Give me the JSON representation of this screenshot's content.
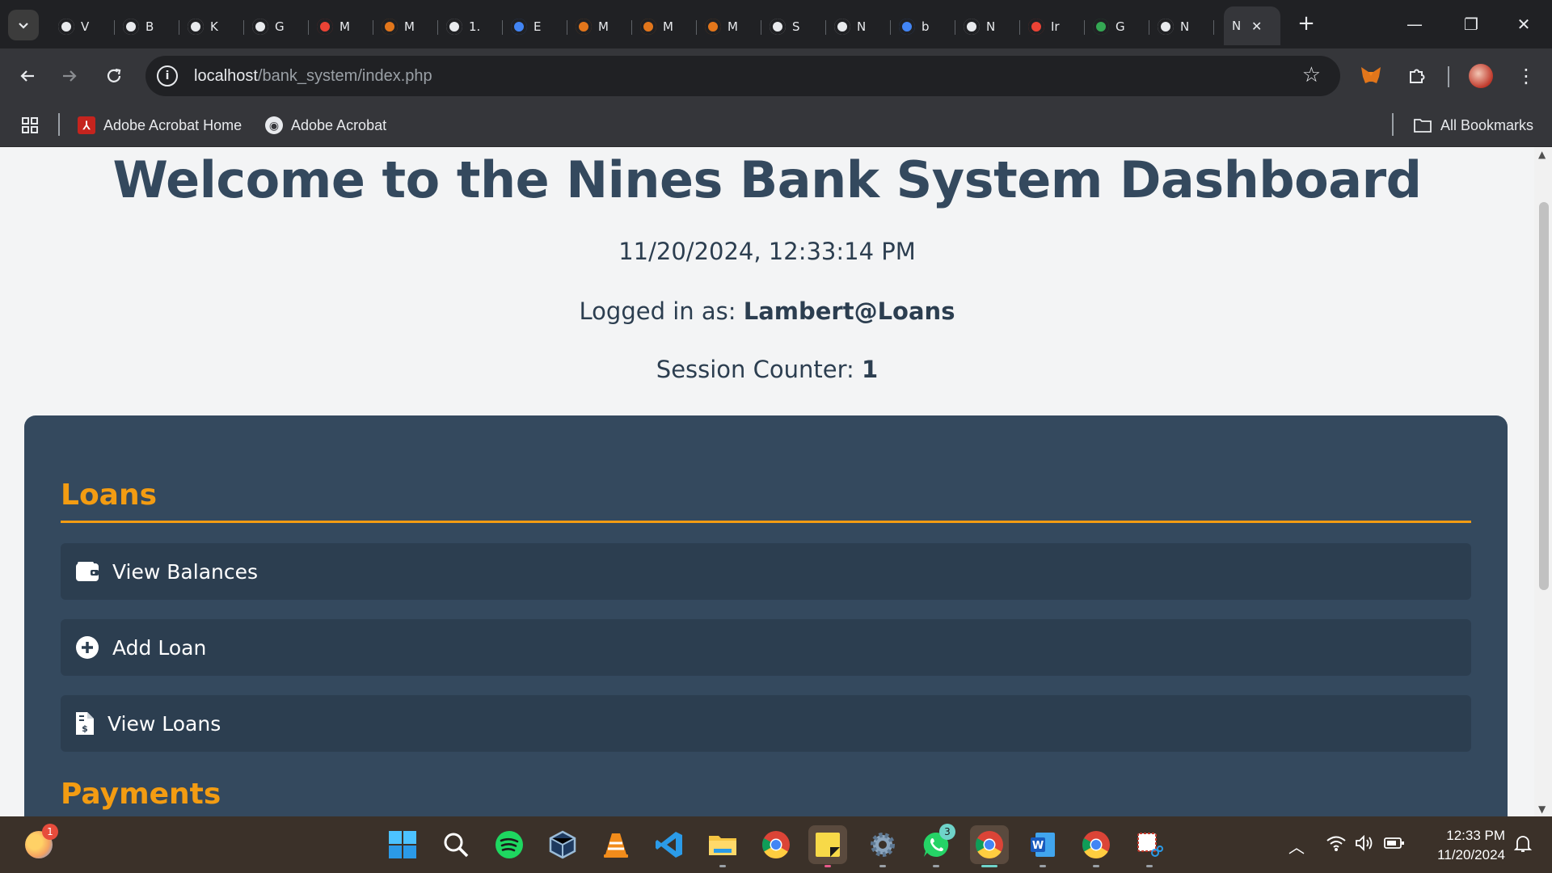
{
  "browser": {
    "tabs": [
      {
        "label": "V",
        "icon": "chrome-icon",
        "color": "#e8eaed"
      },
      {
        "label": "B",
        "icon": "openai-icon",
        "color": "#e8eaed"
      },
      {
        "label": "K",
        "icon": "github-icon",
        "color": "#e8eaed"
      },
      {
        "label": "G",
        "icon": "globe-icon",
        "color": "#e8eaed"
      },
      {
        "label": "M",
        "icon": "rainbow-icon",
        "color": "#ea4335"
      },
      {
        "label": "M",
        "icon": "metamask-icon",
        "color": "#e2761b"
      },
      {
        "label": "1.",
        "icon": "globe-icon",
        "color": "#e8eaed"
      },
      {
        "label": "E",
        "icon": "google-cloud-icon",
        "color": "#4285f4"
      },
      {
        "label": "M",
        "icon": "metamask-icon",
        "color": "#e2761b"
      },
      {
        "label": "M",
        "icon": "metamask-icon",
        "color": "#e2761b"
      },
      {
        "label": "M",
        "icon": "metamask-icon",
        "color": "#e2761b"
      },
      {
        "label": "S",
        "icon": "chart-icon",
        "color": "#e8eaed"
      },
      {
        "label": "N",
        "icon": "github-icon",
        "color": "#e8eaed"
      },
      {
        "label": "b",
        "icon": "google-icon",
        "color": "#4285f4"
      },
      {
        "label": "N",
        "icon": "chrome-icon",
        "color": "#e8eaed"
      },
      {
        "label": "Ir",
        "icon": "gmail-icon",
        "color": "#ea4335"
      },
      {
        "label": "G",
        "icon": "google-lens-icon",
        "color": "#34a853"
      },
      {
        "label": "N",
        "icon": "chrome-icon",
        "color": "#e8eaed"
      }
    ],
    "active_tab": {
      "label": "N",
      "close": "✕"
    },
    "new_tab": "+",
    "window_controls": {
      "minimize": "—",
      "restore": "❐",
      "close": "✕"
    },
    "url": {
      "host": "localhost",
      "path": "/bank_system/index.php"
    },
    "bookmarks": [
      {
        "label": "Adobe Acrobat Home",
        "icon": "adobe-pdf-icon"
      },
      {
        "label": "Adobe Acrobat",
        "icon": "globe-icon"
      }
    ],
    "all_bookmarks": "All Bookmarks"
  },
  "dashboard": {
    "title": "Welcome to the Nines Bank System Dashboard",
    "datetime": "11/20/2024, 12:33:14 PM",
    "logged_in_label": "Logged in as: ",
    "logged_in_user": "Lambert@Loans",
    "session_label": "Session Counter: ",
    "session_count": "1",
    "sections": [
      {
        "title": "Loans",
        "items": [
          {
            "label": "View Balances",
            "icon": "wallet-icon"
          },
          {
            "label": "Add Loan",
            "icon": "plus-circle-icon"
          },
          {
            "label": "View Loans",
            "icon": "file-invoice-dollar-icon"
          }
        ]
      },
      {
        "title": "Payments",
        "items": []
      }
    ],
    "colors": {
      "accent": "#f39c12",
      "panel": "#34495e",
      "item": "#2c3e50",
      "heading": "#34495e"
    }
  },
  "taskbar": {
    "weather_badge": "1",
    "whatsapp_badge": "3",
    "clock_time": "12:33 PM",
    "clock_date": "11/20/2024"
  }
}
